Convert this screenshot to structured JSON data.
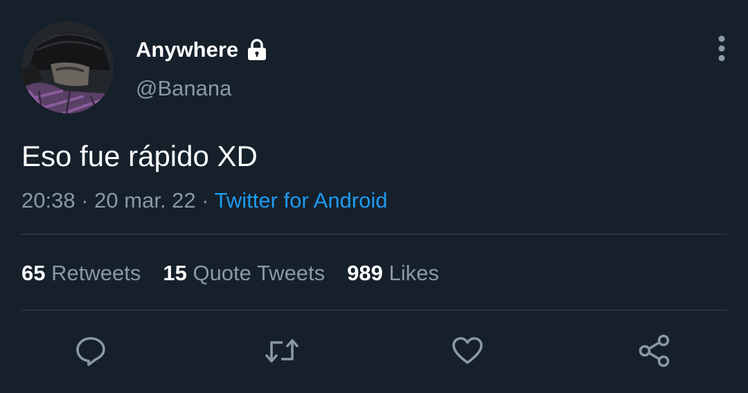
{
  "author": {
    "display_name": "Anywhere",
    "handle": "@Banana",
    "verified_icon": "lock-icon"
  },
  "tweet": {
    "text": "Eso fue rápido XD",
    "time": "20:38",
    "separator": "·",
    "date": "20 mar. 22",
    "source": "Twitter for Android"
  },
  "stats": [
    {
      "count": "65",
      "label": "Retweets"
    },
    {
      "count": "15",
      "label": "Quote Tweets"
    },
    {
      "count": "989",
      "label": "Likes"
    }
  ],
  "actions": [
    {
      "name": "reply",
      "icon": "speech-bubble-icon"
    },
    {
      "name": "retweet",
      "icon": "retweet-arrows-icon"
    },
    {
      "name": "like",
      "icon": "heart-icon"
    },
    {
      "name": "share",
      "icon": "share-nodes-icon"
    }
  ],
  "colors": {
    "background": "#15202b",
    "text_primary": "#ffffff",
    "text_secondary": "#8b98a5",
    "link": "#1d9bf0",
    "divider": "#38444d"
  }
}
